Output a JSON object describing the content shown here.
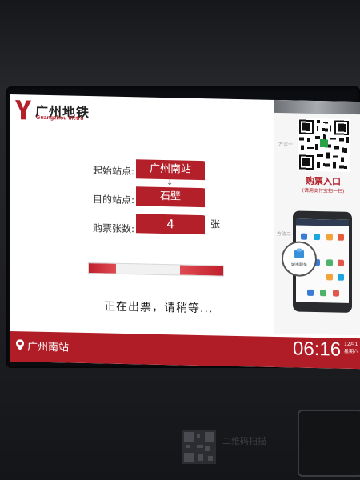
{
  "brand": {
    "name_cn": "广州地铁",
    "name_en": "Guangzhou Metro",
    "color": "#b3202a"
  },
  "ticket_form": {
    "origin": {
      "label": "起始站点:",
      "value": "广州南站"
    },
    "destination": {
      "label": "目的站点:",
      "value": "石壁"
    },
    "quantity": {
      "label": "购票张数:",
      "value": "4",
      "unit": "张"
    }
  },
  "progress": {
    "left_fraction": 0.2,
    "right_fraction": 0.32
  },
  "status_text": "正在出票，请稍等...",
  "payment_panel": {
    "method_one_label": "方法一",
    "method_two_label": "方法二",
    "qr_title": "购票入口",
    "qr_subtitle": "(请用支付宝扫一扫)",
    "phone_hint": "城市服务"
  },
  "footer": {
    "station": "广州南站",
    "time": "06:16",
    "date": "12月1",
    "weekday": "星期六"
  },
  "lower_panel": {
    "text": "二维码扫描"
  },
  "colors": {
    "accent": "#b3202a",
    "bar": "#b11d27"
  }
}
